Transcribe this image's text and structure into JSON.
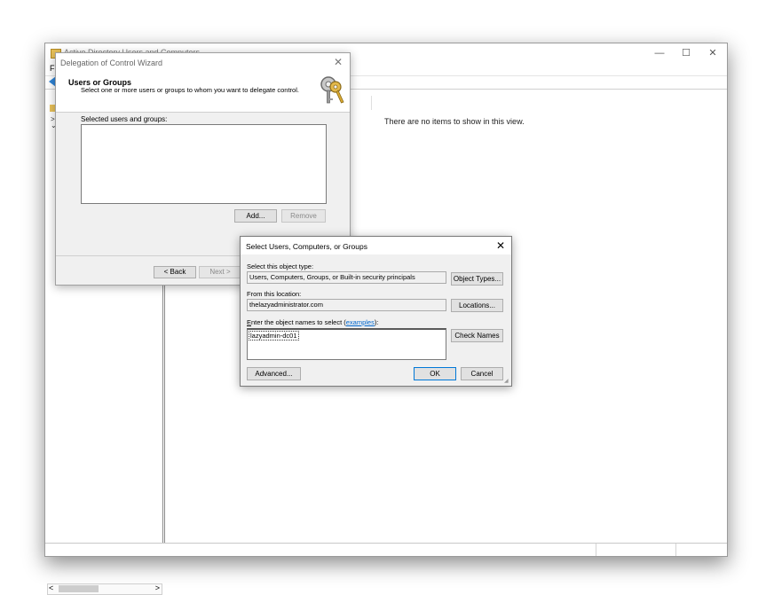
{
  "main_window": {
    "title": "Active Directory Users and Computers",
    "menu_first": "F",
    "minimize": "—",
    "maximize": "☐",
    "close": "✕",
    "empty_message": "There are no items to show in this view.",
    "tree_chevron_1": ">",
    "tree_chevron_2": "⌄",
    "scroll_left": "<",
    "scroll_right": ">"
  },
  "wizard": {
    "title": "Delegation of Control Wizard",
    "close": "✕",
    "heading": "Users or Groups",
    "description": "Select one or more users or groups to whom you want to delegate control.",
    "selected_label": "Selected users and groups:",
    "add_button": "Add...",
    "remove_button": "Remove",
    "back_button": "< Back",
    "next_button": "Next >"
  },
  "select_dialog": {
    "title": "Select Users, Computers, or Groups",
    "close": "✕",
    "object_type_label": "Select this object type:",
    "object_type_value": "Users, Computers, Groups, or Built-in security principals",
    "object_types_button": "Object Types...",
    "location_label": "From this location:",
    "location_value": "thelazyadministrator.com",
    "locations_button": "Locations...",
    "names_label_underlined": "E",
    "names_label_rest": "nter the object names to select (",
    "names_label_link": "examples",
    "names_label_end": "):",
    "names_value": "lazyadmin-dc01",
    "check_names_button": "Check Names",
    "advanced_button": "Advanced...",
    "ok_button": "OK",
    "cancel_button": "Cancel"
  },
  "colors": {
    "accent": "#0078d7",
    "link": "#0066cc",
    "dialog_bg": "#f0f0f0"
  }
}
